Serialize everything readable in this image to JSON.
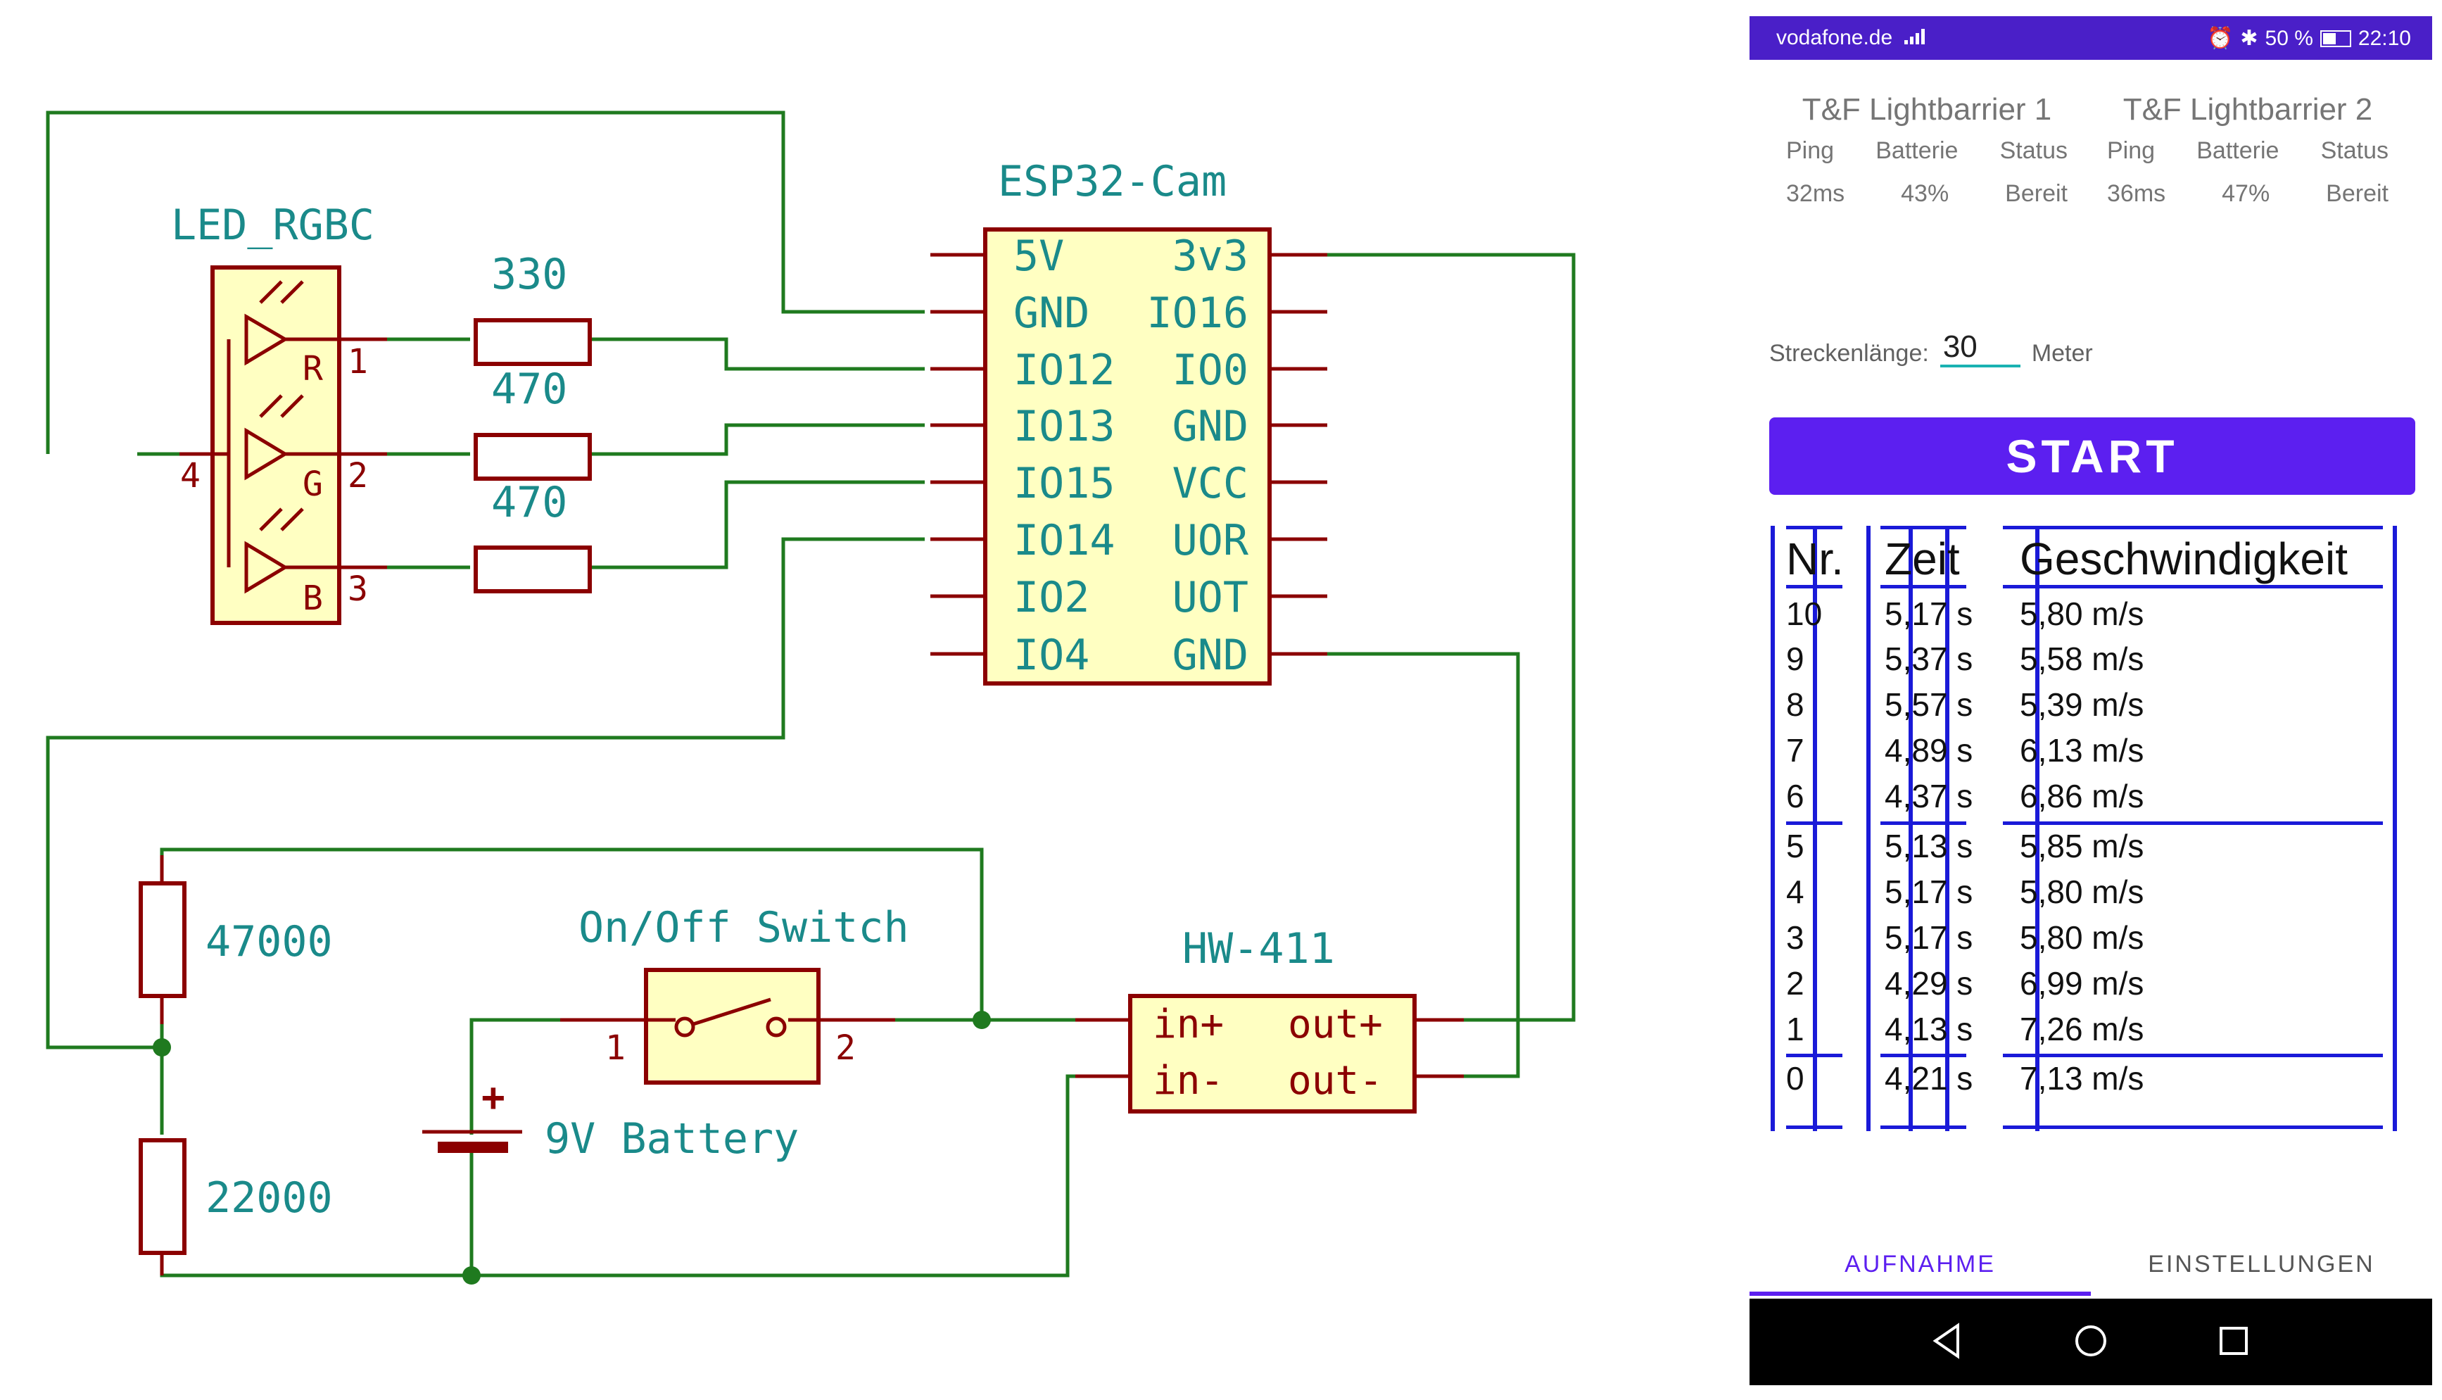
{
  "schematic": {
    "components": {
      "led": {
        "ref": "LED_RGBC",
        "pins": [
          "1",
          "2",
          "3",
          "4"
        ],
        "channels": [
          "R",
          "G",
          "B"
        ]
      },
      "resistors_top": [
        "330",
        "470",
        "470"
      ],
      "resistors_left": [
        "47000",
        "22000"
      ],
      "esp32": {
        "name": "ESP32-Cam",
        "left_pins": [
          "5V",
          "GND",
          "IO12",
          "IO13",
          "IO15",
          "IO14",
          "IO2",
          "IO4"
        ],
        "right_pins": [
          "3v3",
          "IO16",
          "IO0",
          "GND",
          "VCC",
          "UOR",
          "UOT",
          "GND"
        ]
      },
      "switch": {
        "name": "On/Off Switch",
        "pins": [
          "1",
          "2"
        ]
      },
      "battery": {
        "name": "9V Battery",
        "polarity": "+"
      },
      "converter": {
        "name": "HW-411",
        "left_pins": [
          "in+",
          "in-"
        ],
        "right_pins": [
          "out+",
          "out-"
        ]
      }
    },
    "colors": {
      "wire": "#1f7a1f",
      "pin": "#8b0000",
      "label": "#1a8a8a",
      "body_fill": "#ffffc2"
    }
  },
  "phone": {
    "status_bar": {
      "carrier": "vodafone.de",
      "battery": "50 %",
      "time": "22:10"
    },
    "barriers": [
      {
        "title": "T&F Lightbarrier 1",
        "headers": [
          "Ping",
          "Batterie",
          "Status"
        ],
        "values": [
          "32ms",
          "43%",
          "Bereit"
        ]
      },
      {
        "title": "T&F Lightbarrier 2",
        "headers": [
          "Ping",
          "Batterie",
          "Status"
        ],
        "values": [
          "36ms",
          "47%",
          "Bereit"
        ]
      }
    ],
    "track": {
      "label": "Streckenlänge:",
      "value": "30",
      "unit": "Meter"
    },
    "start_label": "START",
    "table": {
      "headers": [
        "Nr.",
        "Zeit",
        "Geschwindigkeit"
      ],
      "rows": [
        [
          "10",
          "5,17 s",
          "5,80 m/s"
        ],
        [
          "9",
          "5,37 s",
          "5,58 m/s"
        ],
        [
          "8",
          "5,57 s",
          "5,39 m/s"
        ],
        [
          "7",
          "4,89 s",
          "6,13 m/s"
        ],
        [
          "6",
          "4,37 s",
          "6,86 m/s"
        ],
        [
          "5",
          "5,13 s",
          "5,85 m/s"
        ],
        [
          "4",
          "5,17 s",
          "5,80 m/s"
        ],
        [
          "3",
          "5,17 s",
          "5,80 m/s"
        ],
        [
          "2",
          "4,29 s",
          "6,99 m/s"
        ],
        [
          "1",
          "4,13 s",
          "7,26 m/s"
        ],
        [
          "0",
          "4,21 s",
          "7,13 m/s"
        ]
      ]
    },
    "tabs": [
      "AUFNAHME",
      "EINSTELLUNGEN"
    ],
    "active_tab": "AUFNAHME",
    "colors": {
      "status_bar": "#4a1fc8",
      "accent": "#5c1ff0",
      "table_lines": "#1a1ad8",
      "input_underline": "#1ab2b2"
    },
    "nav_icons": [
      "back-icon",
      "home-icon",
      "recents-icon"
    ]
  }
}
